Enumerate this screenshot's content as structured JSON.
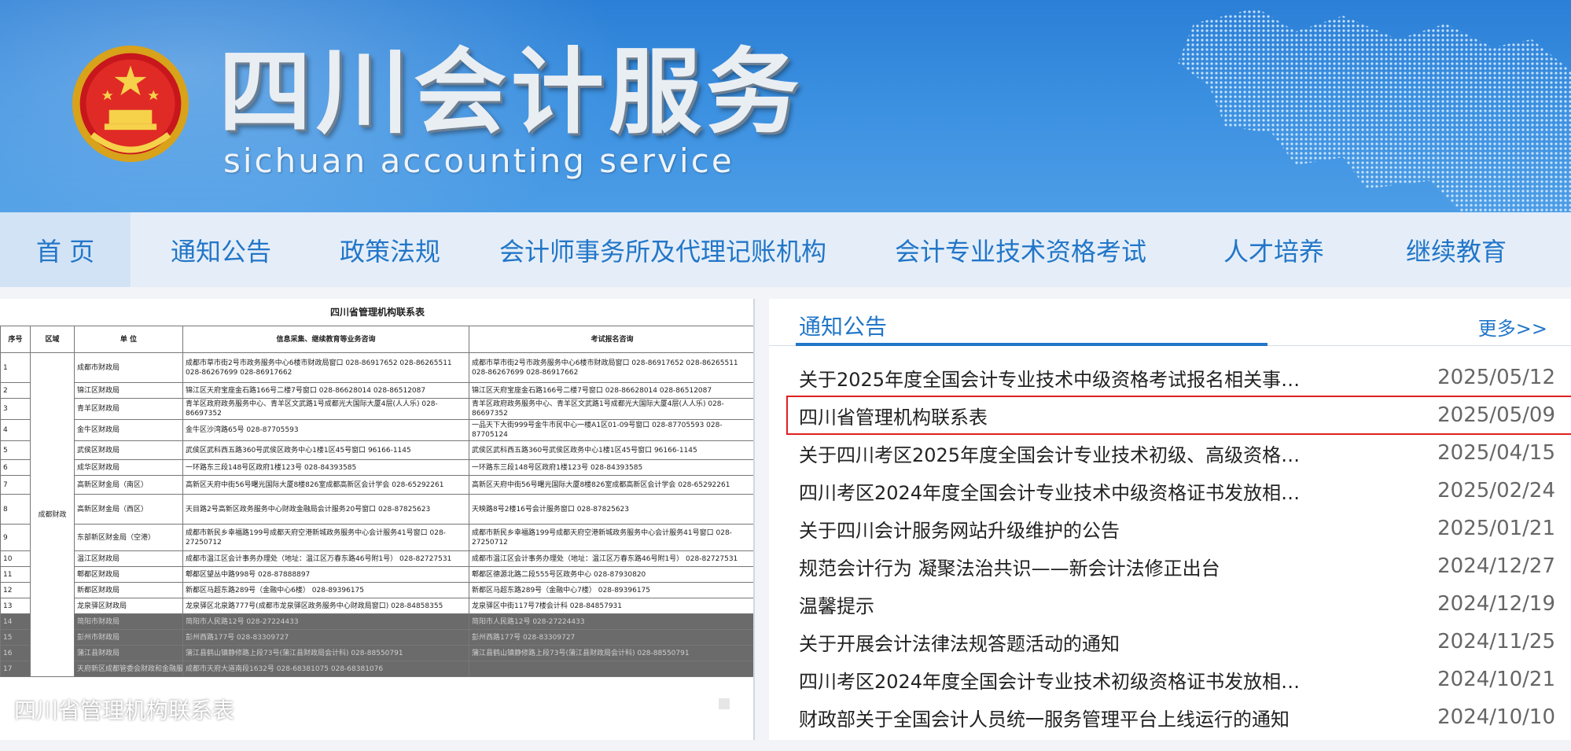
{
  "banner": {
    "title_cn": "四川会计服务",
    "title_en": "sichuan accounting service"
  },
  "nav": {
    "items": [
      {
        "label": "首 页"
      },
      {
        "label": "通知公告"
      },
      {
        "label": "政策法规"
      },
      {
        "label": "会计师事务所及代理记账机构"
      },
      {
        "label": "会计专业技术资格考试"
      },
      {
        "label": "人才培养"
      },
      {
        "label": "继续教育"
      }
    ]
  },
  "slider": {
    "caption": "四川省管理机构联系表",
    "doc": {
      "title": "四川省管理机构联系表",
      "headers": [
        "序号",
        "区域",
        "单 位",
        "信息采集、继续教育等业务咨询",
        "考试报名咨询"
      ],
      "region": "成都财政",
      "rows": [
        {
          "no": "1",
          "unit": "成都市财政局",
          "info": "成都市草市街2号市政务服务中心6楼市财政局窗口 028-86917652 028-86265511 028-86267699 028-86917662",
          "exam": "成都市草市街2号市政务服务中心6楼市财政局窗口 028-86917652 028-86265511 028-86267699 028-86917662"
        },
        {
          "no": "2",
          "unit": "锦江区财政局",
          "info": "锦江区天府宝座金石路166号二楼7号窗口 028-86628014 028-86512087",
          "exam": "锦江区天府宝座金石路166号二楼7号窗口 028-86628014 028-86512087"
        },
        {
          "no": "3",
          "unit": "青羊区财政局",
          "info": "青羊区政府政务服务中心、青羊区文武路1号成都光大国际大厦4层(人人乐) 028-86697352",
          "exam": "青羊区政府政务服务中心、青羊区文武路1号成都光大国际大厦4层(人人乐) 028-86697352"
        },
        {
          "no": "4",
          "unit": "金牛区财政局",
          "info": "金牛区沙湾路65号 028-87705593",
          "exam": "一品天下大街999号金牛市民中心一楼A1区01-09号窗口 028-87705593 028-87705124"
        },
        {
          "no": "5",
          "unit": "武侯区财政局",
          "info": "武侯区武科西五路360号武侯区政务中心1楼1区45号窗口 96166-1145",
          "exam": "武侯区武科西五路360号武侯区政务中心1楼1区45号窗口 96166-1145"
        },
        {
          "no": "6",
          "unit": "成华区财政局",
          "info": "一环路东三段148号区政府1楼123号 028-84393585",
          "exam": "一环路东三段148号区政府1楼123号 028-84393585"
        },
        {
          "no": "7",
          "unit": "高新区财金局（南区）",
          "info": "高新区天府中街56号曙光国际大厦8楼826室成都高新区会计学会 028-65292261",
          "exam": "高新区天府中街56号曙光国际大厦8楼826室成都高新区会计学会 028-65292261"
        },
        {
          "no": "8",
          "unit": "高新区财金局（西区）",
          "info": "天目路2号高新区政务服务中心财政金融局会计服务20号窗口 028-87825623",
          "exam": "天映路8号2楼16号会计服务窗口 028-87825623"
        },
        {
          "no": "9",
          "unit": "东部新区财金局（空港）",
          "info": "成都市新民乡幸福路199号成都天府空港新城政务服务中心会计服务41号窗口 028-27250712",
          "exam": "成都市新民乡幸福路199号成都天府空港新城政务服务中心会计服务41号窗口 028-27250712"
        },
        {
          "no": "10",
          "unit": "温江区财政局",
          "info": "成都市温江区会计事务办理处（地址：温江区万春东路46号附1号） 028-82727531",
          "exam": "成都市温江区会计事务办理处（地址：温江区万春东路46号附1号） 028-82727531"
        },
        {
          "no": "11",
          "unit": "郫都区财政局",
          "info": "郫都区望丛中路998号 028-87888897",
          "exam": "郫都区德源北路二段555号区政务中心 028-87930820"
        },
        {
          "no": "12",
          "unit": "新都区财政局",
          "info": "新都区马超东路289号（金融中心6楼） 028-89396175",
          "exam": "新都区马超东路289号（金融中心7楼） 028-89396175"
        },
        {
          "no": "13",
          "unit": "龙泉驿区财政局",
          "info": "龙泉驿区北泉路777号(成都市龙泉驿区政务服务中心财政局窗口) 028-84858355",
          "exam": "龙泉驿区中街117号7楼会计科 028-84857931"
        },
        {
          "no": "14",
          "unit": "简阳市财政局",
          "info": "简阳市人民路12号 028-27224433",
          "exam": "简阳市人民路12号 028-27224433"
        },
        {
          "no": "15",
          "unit": "彭州市财政局",
          "info": "彭州西路177号 028-83309727",
          "exam": "彭州西路177号 028-83309727"
        },
        {
          "no": "16",
          "unit": "蒲江县财政局",
          "info": "蒲江县鹤山镇静修路上段73号(蒲江县财政局会计科) 028-88550791",
          "exam": "蒲江县鹤山镇静修路上段73号(蒲江县财政局会计科) 028-88550791"
        },
        {
          "no": "17",
          "unit": "天府新区成都管委会财政和金融服务局",
          "info": "成都市天府大道南段1632号 028-68381075 028-68381076",
          "exam": ""
        }
      ]
    }
  },
  "notice": {
    "title": "通知公告",
    "more": "更多>>",
    "items": [
      {
        "text": "关于2025年度全国会计专业技术中级资格考试报名相关事项的...",
        "date": "2025/05/12"
      },
      {
        "text": "四川省管理机构联系表",
        "date": "2025/05/09"
      },
      {
        "text": "关于四川考区2025年度全国会计专业技术初级、高级资格考试...",
        "date": "2025/04/15"
      },
      {
        "text": "四川考区2024年度全国会计专业技术中级资格证书发放相关事...",
        "date": "2025/02/24"
      },
      {
        "text": "关于四川会计服务网站升级维护的公告",
        "date": "2025/01/21"
      },
      {
        "text": "规范会计行为 凝聚法治共识——新会计法修正出台",
        "date": "2024/12/27"
      },
      {
        "text": "温馨提示",
        "date": "2024/12/19"
      },
      {
        "text": "关于开展会计法律法规答题活动的通知",
        "date": "2024/11/25"
      },
      {
        "text": "四川考区2024年度全国会计专业技术初级资格证书发放相关事...",
        "date": "2024/10/21"
      },
      {
        "text": "财政部关于全国会计人员统一服务管理平台上线运行的通知",
        "date": "2024/10/10"
      }
    ]
  },
  "colors": {
    "accent": "#2276c8",
    "banner": "#3a8fe0",
    "nav_bg": "#e5eef8",
    "highlight_border": "#e02020"
  }
}
